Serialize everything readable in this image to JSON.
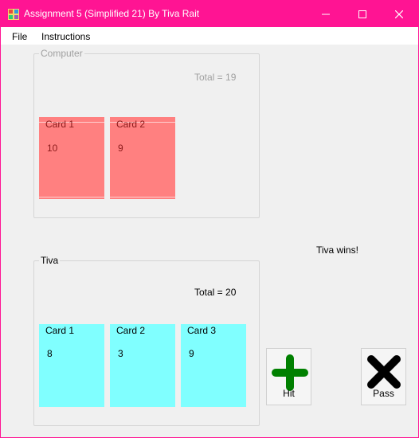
{
  "window": {
    "title": "Assignment 5 (Simplified 21) By Tiva Rait",
    "controls": [
      "minimize-icon",
      "maximize-icon",
      "close-icon"
    ]
  },
  "menu": {
    "items": [
      "File",
      "Instructions"
    ]
  },
  "computer": {
    "label": "Computer",
    "total": "Total = 19",
    "cards": [
      {
        "label": "Card 1",
        "value": "10"
      },
      {
        "label": "Card 2",
        "value": "9"
      }
    ]
  },
  "player": {
    "label": "Tiva",
    "total": "Total = 20",
    "cards": [
      {
        "label": "Card 1",
        "value": "8"
      },
      {
        "label": "Card 2",
        "value": "3"
      },
      {
        "label": "Card 3",
        "value": "9"
      }
    ]
  },
  "status": {
    "message": "Tiva wins!"
  },
  "actions": {
    "hit": {
      "label": "Hit",
      "icon": "plus-icon"
    },
    "pass": {
      "label": "Pass",
      "icon": "x-icon"
    }
  },
  "colors": {
    "titlebar": "#ff1493",
    "computer_card": "#ff8080",
    "player_card": "#80ffff",
    "hit_icon": "#008000",
    "pass_icon": "#000000"
  }
}
